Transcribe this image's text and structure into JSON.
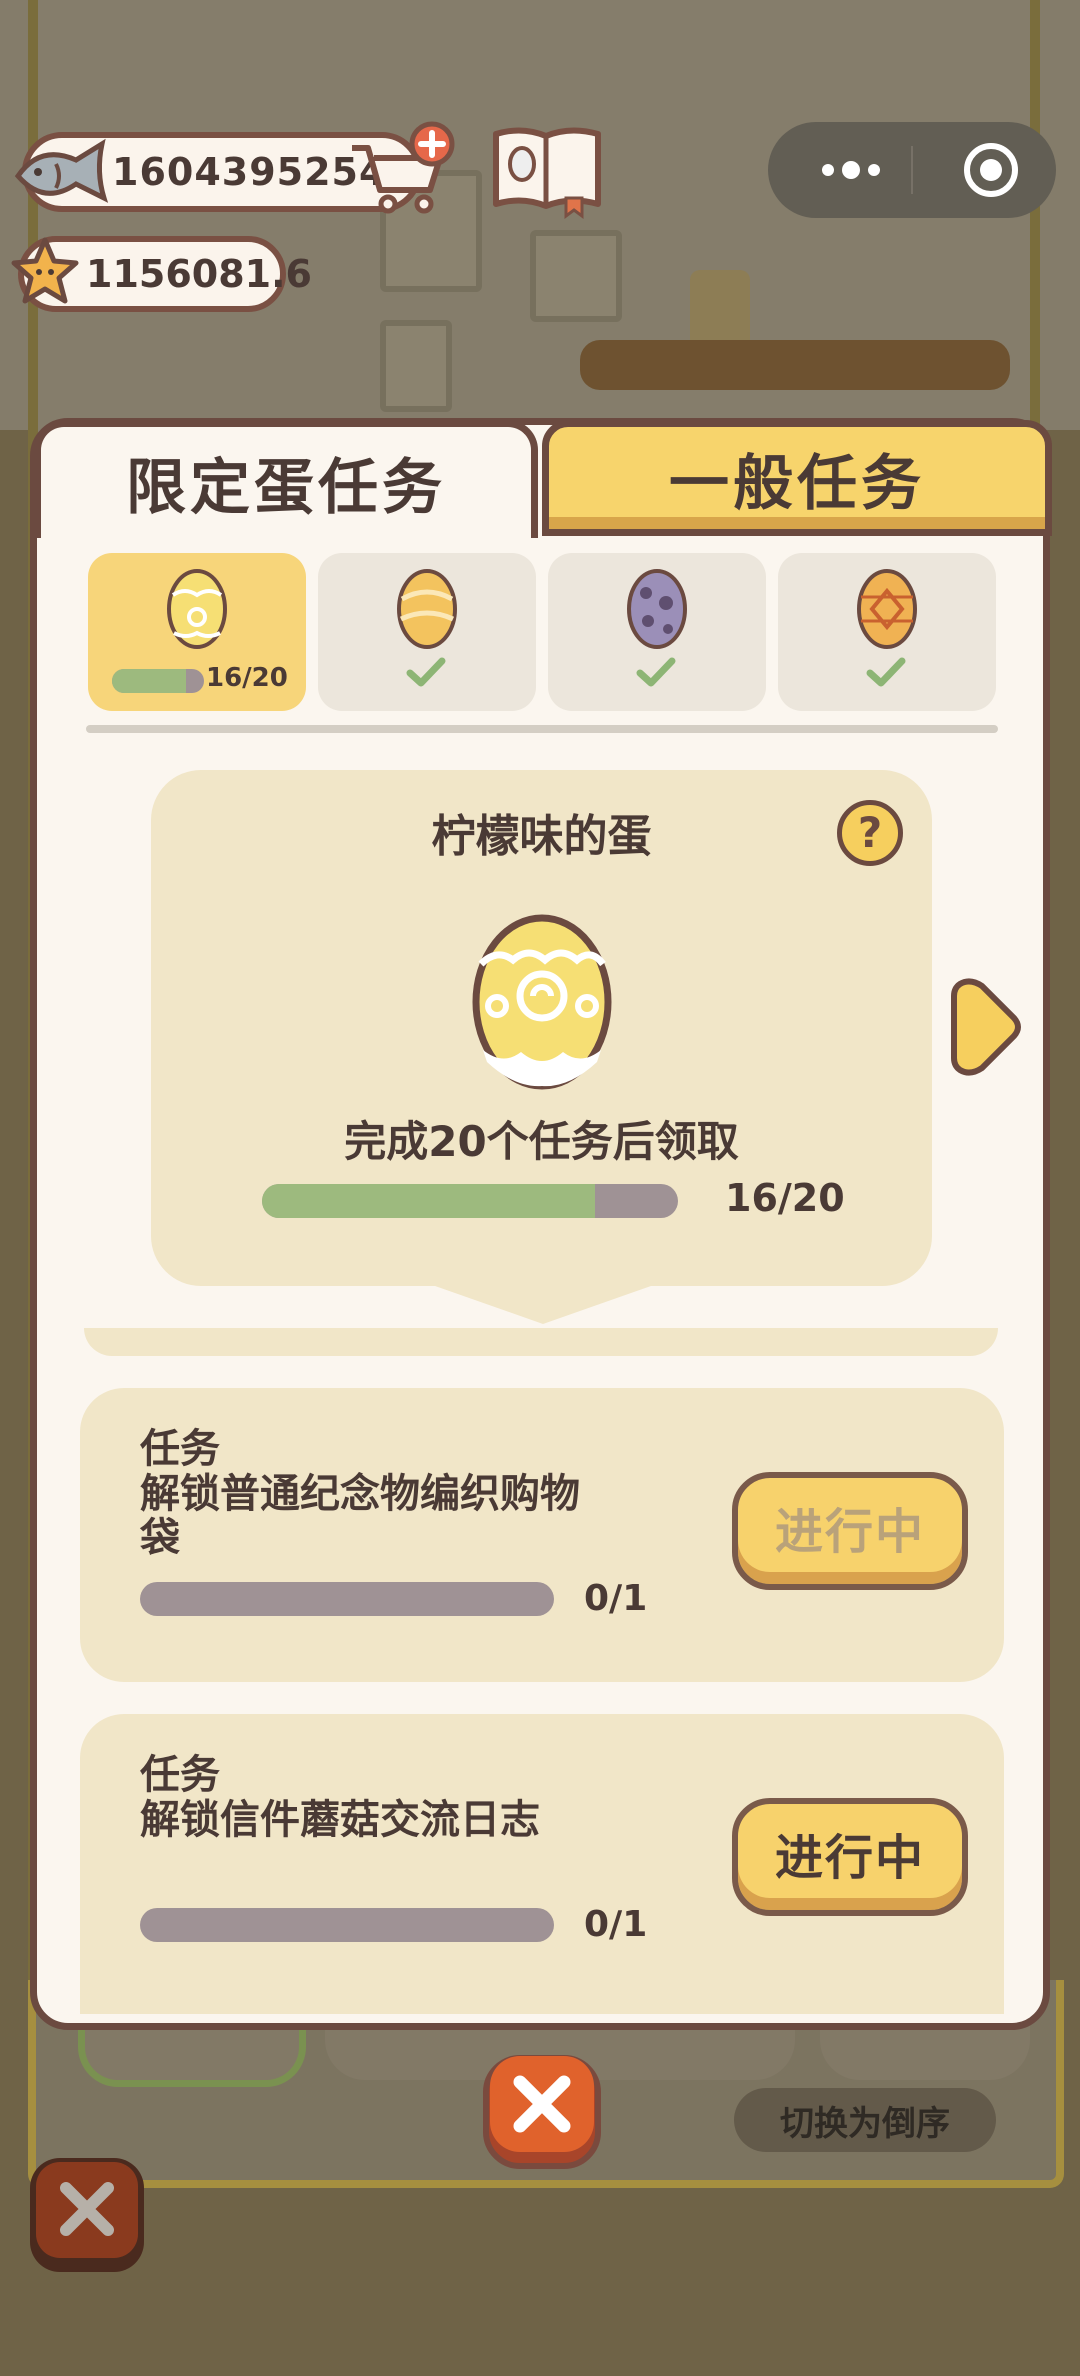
{
  "hud": {
    "fish_value": "16043952543",
    "star_value": "1156081.6"
  },
  "tabs": [
    {
      "label": "限定蛋任务",
      "active": true
    },
    {
      "label": "一般任务",
      "active": false
    }
  ],
  "egg_selector": [
    {
      "icon": "lemon-egg-icon",
      "selected": true,
      "progress_text": "16/20",
      "progress": 0.8
    },
    {
      "icon": "orange-egg-icon",
      "selected": false,
      "completed": true
    },
    {
      "icon": "purple-spotted-egg-icon",
      "selected": false,
      "completed": true
    },
    {
      "icon": "diamond-egg-icon",
      "selected": false,
      "completed": true
    }
  ],
  "reward": {
    "title": "柠檬味的蛋",
    "condition": "完成20个任务后领取",
    "progress_text": "16/20",
    "progress": 0.8
  },
  "tasks": [
    {
      "label": "任务",
      "description": "解锁普通纪念物编织购物袋",
      "progress_text": "0/1",
      "status": "进行中",
      "status_enabled": false
    },
    {
      "label": "任务",
      "description": "解锁信件蘑菇交流日志",
      "progress_text": "0/1",
      "status": "进行中",
      "status_enabled": true
    }
  ],
  "sort_button": "切换为倒序",
  "colors": {
    "panel_bg": "#fbf6ef",
    "accent_yellow": "#f7d26c",
    "progress_green": "#9dba7e",
    "progress_track": "#9f9295",
    "close_orange": "#e0622c",
    "outline_brown": "#6b4a40"
  }
}
